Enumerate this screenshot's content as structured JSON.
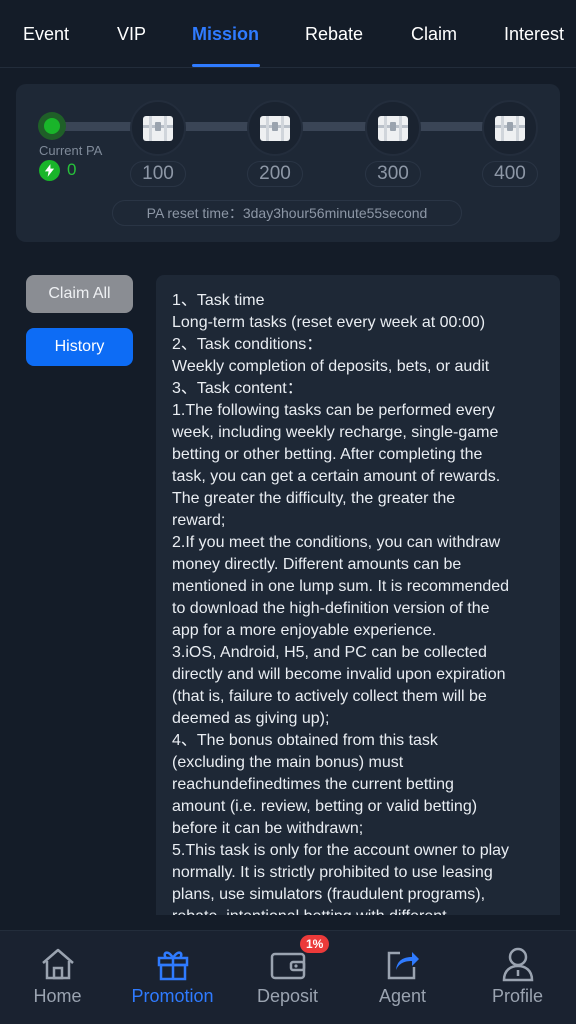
{
  "tabs": [
    {
      "label": "Event"
    },
    {
      "label": "VIP"
    },
    {
      "label": "Mission"
    },
    {
      "label": "Rebate"
    },
    {
      "label": "Claim"
    },
    {
      "label": "Interest"
    }
  ],
  "active_tab": "Mission",
  "progress": {
    "current_label": "Current PA",
    "current_value": "0",
    "milestones": [
      "100",
      "200",
      "300",
      "400"
    ],
    "reset_text": "PA reset time：3day3hour56minute55second"
  },
  "buttons": {
    "claim_all": "Claim All",
    "history": "History"
  },
  "rules": {
    "lines": [
      "1、Task time",
      "Long-term tasks (reset every week at 00:00)",
      "2、Task conditions：",
      "Weekly completion of deposits, bets, or audit",
      "3、Task content：",
      "1.The following tasks can be performed every",
      "week, including weekly recharge, single-game",
      "betting or other betting. After completing the",
      "task, you can get a certain amount of rewards.",
      "The greater the difficulty, the greater the",
      "reward;",
      "2.If you meet the conditions, you can withdraw",
      "money directly. Different amounts can be",
      "mentioned in one lump sum. It is recommended",
      "to download the high-definition version of the",
      "app for a more enjoyable experience.",
      "3.iOS, Android, H5, and PC can be collected",
      "directly and will become invalid upon expiration",
      "(that is, failure to actively collect them will be",
      "deemed as giving up);",
      "4、The bonus obtained from this task",
      "(excluding the main bonus) must",
      "reachundefinedtimes the current betting",
      "amount (i.e. review, betting or valid betting)",
      "before it can be withdrawn;",
      "5.This task is only for the account owner to play",
      "normally. It is strictly prohibited to use leasing",
      "plans, use simulators (fraudulent programs),",
      "rebate, intentional betting with different"
    ]
  },
  "bottom_nav": [
    {
      "label": "Home",
      "icon": "home-icon"
    },
    {
      "label": "Promotion",
      "icon": "gift-icon"
    },
    {
      "label": "Deposit",
      "icon": "wallet-icon",
      "badge": "1%"
    },
    {
      "label": "Agent",
      "icon": "share-icon"
    },
    {
      "label": "Profile",
      "icon": "profile-icon"
    }
  ],
  "colors": {
    "accent": "#2f7bff",
    "background": "#141c28",
    "card": "#1e2836",
    "progress_green": "#19b52a",
    "history_button": "#0d6cf5",
    "claim_button_disabled": "#8a8d93",
    "badge_red": "#ec3a3a"
  }
}
